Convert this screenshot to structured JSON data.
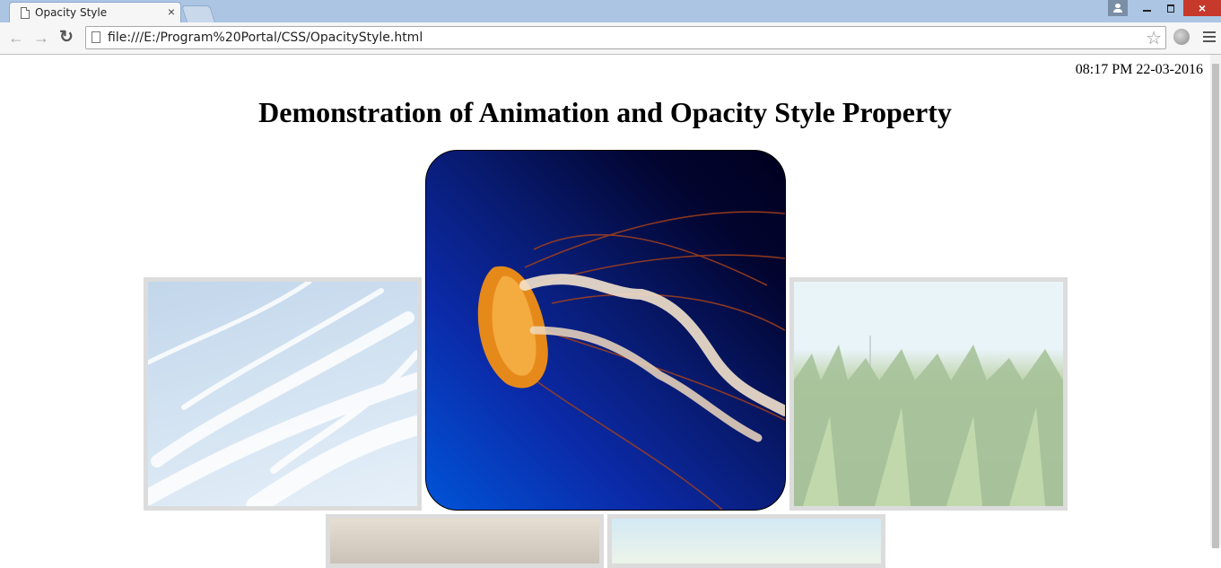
{
  "browser": {
    "tab_title": "Opacity Style",
    "url": "file:///E:/Program%20Portal/CSS/OpacityStyle.html",
    "close_glyph": "×"
  },
  "page": {
    "datetime": "08:17 PM 22-03-2016",
    "heading": "Demonstration of Animation and Opacity Style Property",
    "images": [
      {
        "subject": "sky",
        "opacity": 0.45
      },
      {
        "subject": "jellyfish",
        "opacity": 1
      },
      {
        "subject": "cornfield",
        "opacity": 0.45
      },
      {
        "subject": "animal",
        "opacity": 0.45
      },
      {
        "subject": "landscape",
        "opacity": 0.45
      }
    ]
  },
  "colors": {
    "titlebar": "#abc5e3",
    "close_button": "#c7392b",
    "image_border": "#b3b3b3"
  }
}
